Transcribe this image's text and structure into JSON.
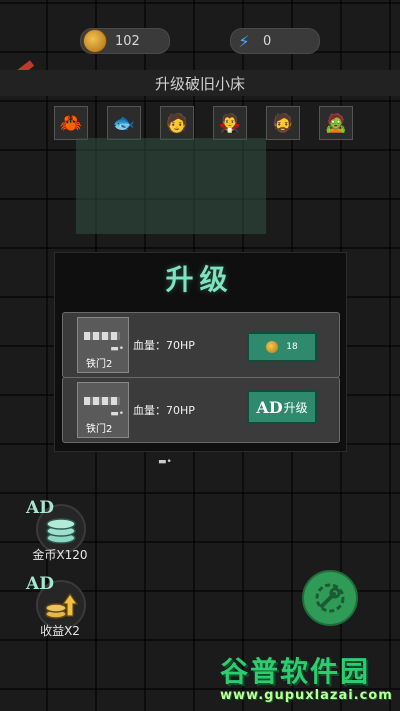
{
  "currency": {
    "coins": "102",
    "energy": "0",
    "coin_icon": "gold-coin-icon",
    "energy_icon": "lightning-bolt-icon"
  },
  "header": {
    "title": "升级破旧小床",
    "back_icon": "back-arrow-icon"
  },
  "characters": [
    {
      "icon": "🦀"
    },
    {
      "icon": "🐟"
    },
    {
      "icon": "🧑"
    },
    {
      "icon": "🧛"
    },
    {
      "icon": "🧔"
    },
    {
      "icon": "🧟"
    }
  ],
  "dialog": {
    "title": "升级",
    "options": [
      {
        "item_name": "铁门2",
        "hp_text": "血量：70HP",
        "cost": "18",
        "cost_icon": "coin-icon"
      },
      {
        "item_name": "铁门2",
        "hp_text": "血量：70HP",
        "ad_mark": "AD",
        "ad_label": "升级"
      }
    ]
  },
  "side_buttons": [
    {
      "ad_mark": "AD",
      "label": "金币X120",
      "icon": "coin-stack-icon"
    },
    {
      "ad_mark": "AD",
      "label": "收益X2",
      "icon": "coin-boost-icon"
    }
  ],
  "watermark": {
    "text": "谷普软件园",
    "url": "www.gupuxlazai.com"
  },
  "colors": {
    "accent_green": "#2f8a6d",
    "title_teal": "#7fe3c0",
    "back_red": "#c0392b",
    "settings_green": "#2f9b57"
  }
}
